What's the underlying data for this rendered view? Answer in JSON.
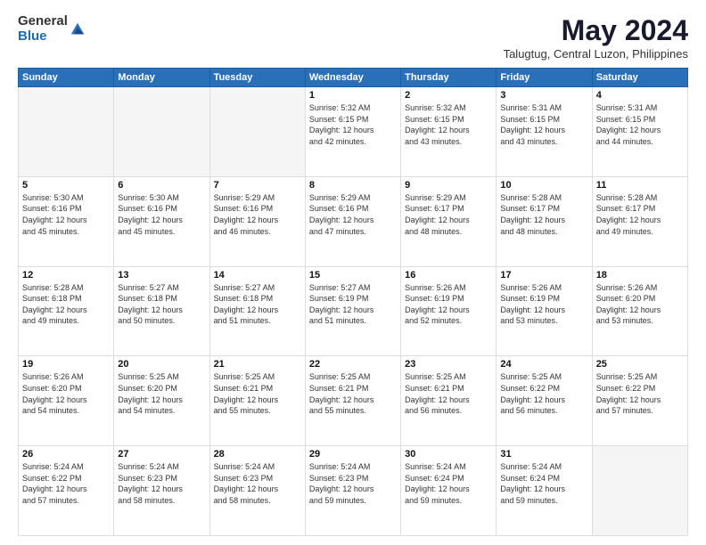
{
  "logo": {
    "general": "General",
    "blue": "Blue"
  },
  "title": {
    "month_year": "May 2024",
    "location": "Talugtug, Central Luzon, Philippines"
  },
  "headers": [
    "Sunday",
    "Monday",
    "Tuesday",
    "Wednesday",
    "Thursday",
    "Friday",
    "Saturday"
  ],
  "weeks": [
    [
      {
        "day": "",
        "info": ""
      },
      {
        "day": "",
        "info": ""
      },
      {
        "day": "",
        "info": ""
      },
      {
        "day": "1",
        "info": "Sunrise: 5:32 AM\nSunset: 6:15 PM\nDaylight: 12 hours\nand 42 minutes."
      },
      {
        "day": "2",
        "info": "Sunrise: 5:32 AM\nSunset: 6:15 PM\nDaylight: 12 hours\nand 43 minutes."
      },
      {
        "day": "3",
        "info": "Sunrise: 5:31 AM\nSunset: 6:15 PM\nDaylight: 12 hours\nand 43 minutes."
      },
      {
        "day": "4",
        "info": "Sunrise: 5:31 AM\nSunset: 6:15 PM\nDaylight: 12 hours\nand 44 minutes."
      }
    ],
    [
      {
        "day": "5",
        "info": "Sunrise: 5:30 AM\nSunset: 6:16 PM\nDaylight: 12 hours\nand 45 minutes."
      },
      {
        "day": "6",
        "info": "Sunrise: 5:30 AM\nSunset: 6:16 PM\nDaylight: 12 hours\nand 45 minutes."
      },
      {
        "day": "7",
        "info": "Sunrise: 5:29 AM\nSunset: 6:16 PM\nDaylight: 12 hours\nand 46 minutes."
      },
      {
        "day": "8",
        "info": "Sunrise: 5:29 AM\nSunset: 6:16 PM\nDaylight: 12 hours\nand 47 minutes."
      },
      {
        "day": "9",
        "info": "Sunrise: 5:29 AM\nSunset: 6:17 PM\nDaylight: 12 hours\nand 48 minutes."
      },
      {
        "day": "10",
        "info": "Sunrise: 5:28 AM\nSunset: 6:17 PM\nDaylight: 12 hours\nand 48 minutes."
      },
      {
        "day": "11",
        "info": "Sunrise: 5:28 AM\nSunset: 6:17 PM\nDaylight: 12 hours\nand 49 minutes."
      }
    ],
    [
      {
        "day": "12",
        "info": "Sunrise: 5:28 AM\nSunset: 6:18 PM\nDaylight: 12 hours\nand 49 minutes."
      },
      {
        "day": "13",
        "info": "Sunrise: 5:27 AM\nSunset: 6:18 PM\nDaylight: 12 hours\nand 50 minutes."
      },
      {
        "day": "14",
        "info": "Sunrise: 5:27 AM\nSunset: 6:18 PM\nDaylight: 12 hours\nand 51 minutes."
      },
      {
        "day": "15",
        "info": "Sunrise: 5:27 AM\nSunset: 6:19 PM\nDaylight: 12 hours\nand 51 minutes."
      },
      {
        "day": "16",
        "info": "Sunrise: 5:26 AM\nSunset: 6:19 PM\nDaylight: 12 hours\nand 52 minutes."
      },
      {
        "day": "17",
        "info": "Sunrise: 5:26 AM\nSunset: 6:19 PM\nDaylight: 12 hours\nand 53 minutes."
      },
      {
        "day": "18",
        "info": "Sunrise: 5:26 AM\nSunset: 6:20 PM\nDaylight: 12 hours\nand 53 minutes."
      }
    ],
    [
      {
        "day": "19",
        "info": "Sunrise: 5:26 AM\nSunset: 6:20 PM\nDaylight: 12 hours\nand 54 minutes."
      },
      {
        "day": "20",
        "info": "Sunrise: 5:25 AM\nSunset: 6:20 PM\nDaylight: 12 hours\nand 54 minutes."
      },
      {
        "day": "21",
        "info": "Sunrise: 5:25 AM\nSunset: 6:21 PM\nDaylight: 12 hours\nand 55 minutes."
      },
      {
        "day": "22",
        "info": "Sunrise: 5:25 AM\nSunset: 6:21 PM\nDaylight: 12 hours\nand 55 minutes."
      },
      {
        "day": "23",
        "info": "Sunrise: 5:25 AM\nSunset: 6:21 PM\nDaylight: 12 hours\nand 56 minutes."
      },
      {
        "day": "24",
        "info": "Sunrise: 5:25 AM\nSunset: 6:22 PM\nDaylight: 12 hours\nand 56 minutes."
      },
      {
        "day": "25",
        "info": "Sunrise: 5:25 AM\nSunset: 6:22 PM\nDaylight: 12 hours\nand 57 minutes."
      }
    ],
    [
      {
        "day": "26",
        "info": "Sunrise: 5:24 AM\nSunset: 6:22 PM\nDaylight: 12 hours\nand 57 minutes."
      },
      {
        "day": "27",
        "info": "Sunrise: 5:24 AM\nSunset: 6:23 PM\nDaylight: 12 hours\nand 58 minutes."
      },
      {
        "day": "28",
        "info": "Sunrise: 5:24 AM\nSunset: 6:23 PM\nDaylight: 12 hours\nand 58 minutes."
      },
      {
        "day": "29",
        "info": "Sunrise: 5:24 AM\nSunset: 6:23 PM\nDaylight: 12 hours\nand 59 minutes."
      },
      {
        "day": "30",
        "info": "Sunrise: 5:24 AM\nSunset: 6:24 PM\nDaylight: 12 hours\nand 59 minutes."
      },
      {
        "day": "31",
        "info": "Sunrise: 5:24 AM\nSunset: 6:24 PM\nDaylight: 12 hours\nand 59 minutes."
      },
      {
        "day": "",
        "info": ""
      }
    ]
  ]
}
